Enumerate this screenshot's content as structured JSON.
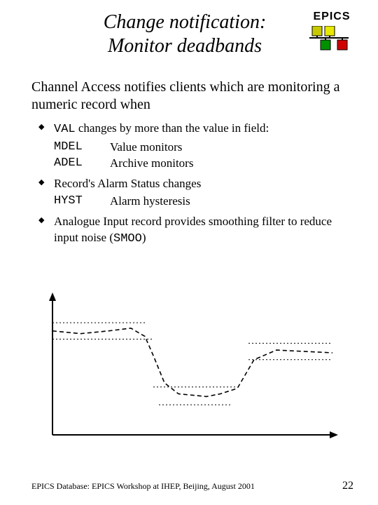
{
  "header": {
    "title_line1": "Change notification:",
    "title_line2": "Monitor deadbands",
    "logo_label": "EPICS"
  },
  "intro": "Channel Access notifies clients which are monitoring a numeric record when",
  "bullets": [
    {
      "lead_mono": "VAL",
      "lead_rest": " changes by more than the value in field:",
      "defs": [
        {
          "term": "MDEL",
          "desc": "Value monitors"
        },
        {
          "term": "ADEL",
          "desc": "Archive monitors"
        }
      ]
    },
    {
      "text": "Record's Alarm Status changes",
      "defs": [
        {
          "term": "HYST",
          "desc": "Alarm hysteresis"
        }
      ]
    },
    {
      "text_pre": "Analogue Input record provides smoothing filter to reduce input noise (",
      "text_mono": "SMOO",
      "text_post": ")"
    }
  ],
  "footer": {
    "left": "EPICS Database: EPICS Workshop at IHEP, Beijing, August 2001",
    "page": "22"
  },
  "logo_colors": {
    "bg": "#000000",
    "c1": "#c0c000",
    "c2": "#e0e000",
    "c3": "#008000",
    "c4": "#d00000"
  },
  "chart_data": {
    "type": "line",
    "title": "",
    "xlabel": "",
    "ylabel": "",
    "xlim": [
      0,
      100
    ],
    "ylim": [
      0,
      100
    ],
    "series": [
      {
        "name": "signal-smoothed",
        "style": "dashed-black",
        "x": [
          0,
          10,
          20,
          28,
          33,
          36,
          40,
          45,
          55,
          60,
          66,
          72,
          80,
          90,
          100
        ],
        "y": [
          76,
          74,
          76,
          78,
          72,
          58,
          38,
          30,
          28,
          30,
          34,
          55,
          62,
          61,
          60
        ]
      },
      {
        "name": "upper-band-left",
        "style": "dotted",
        "x": [
          0,
          33
        ],
        "y": [
          82,
          82
        ]
      },
      {
        "name": "lower-band-left",
        "style": "dotted",
        "x": [
          0,
          36
        ],
        "y": [
          70,
          70
        ]
      },
      {
        "name": "upper-band-mid",
        "style": "dotted",
        "x": [
          36,
          66
        ],
        "y": [
          35,
          35
        ]
      },
      {
        "name": "lower-band-mid",
        "style": "dotted",
        "x": [
          38,
          64
        ],
        "y": [
          22,
          22
        ]
      },
      {
        "name": "upper-band-right",
        "style": "dotted",
        "x": [
          70,
          100
        ],
        "y": [
          67,
          67
        ]
      },
      {
        "name": "lower-band-right",
        "style": "dotted",
        "x": [
          70,
          100
        ],
        "y": [
          55,
          55
        ]
      }
    ]
  }
}
